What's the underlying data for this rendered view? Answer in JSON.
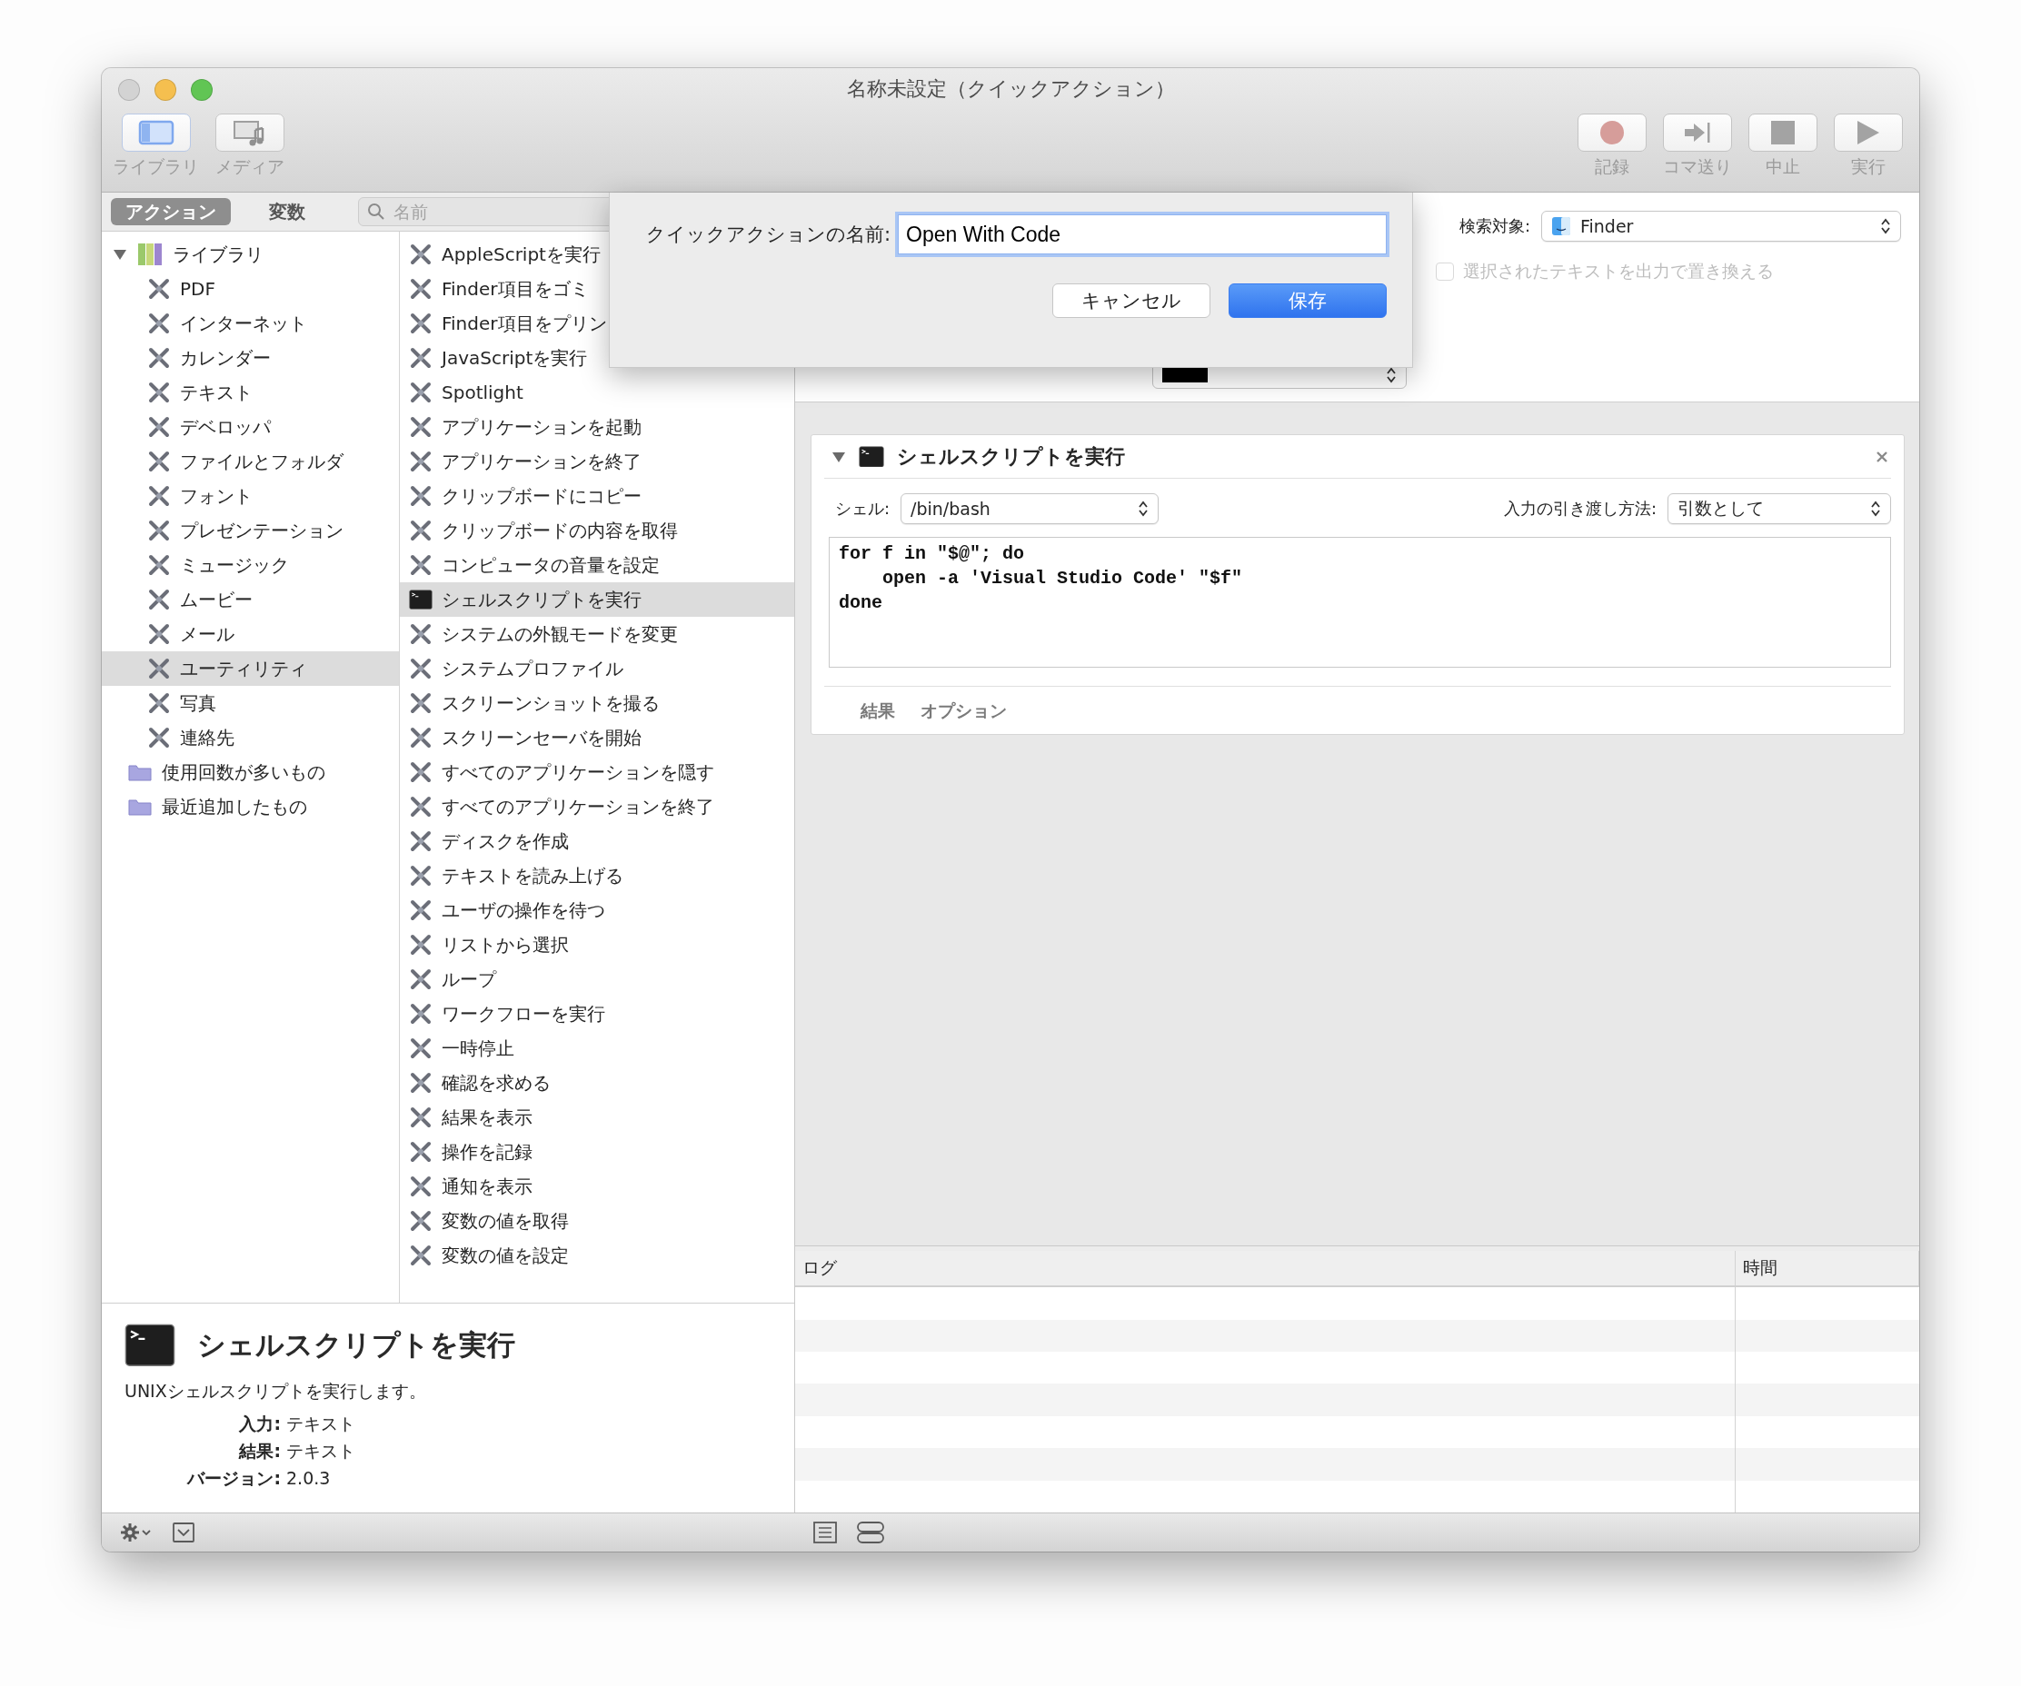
{
  "window": {
    "title": "名称未設定（クイックアクション）"
  },
  "toolbar": {
    "left": [
      {
        "label": "ライブラリ",
        "kind": "library",
        "selected": true
      },
      {
        "label": "メディア",
        "kind": "media",
        "selected": false
      }
    ],
    "right": [
      {
        "label": "記録",
        "kind": "record"
      },
      {
        "label": "コマ送り",
        "kind": "step"
      },
      {
        "label": "中止",
        "kind": "stop"
      },
      {
        "label": "実行",
        "kind": "run"
      }
    ]
  },
  "library_tabs": [
    {
      "label": "アクション",
      "selected": true
    },
    {
      "label": "変数",
      "selected": false
    }
  ],
  "search": {
    "placeholder": "名前"
  },
  "library": [
    {
      "label": "ライブラリ",
      "selected": false,
      "expanded": true,
      "children": [
        {
          "label": "PDF",
          "selected": false
        },
        {
          "label": "インターネット",
          "selected": false
        },
        {
          "label": "カレンダー",
          "selected": false
        },
        {
          "label": "テキスト",
          "selected": false
        },
        {
          "label": "デベロッパ",
          "selected": false
        },
        {
          "label": "ファイルとフォルダ",
          "selected": false
        },
        {
          "label": "フォント",
          "selected": false
        },
        {
          "label": "プレゼンテーション",
          "selected": false
        },
        {
          "label": "ミュージック",
          "selected": false
        },
        {
          "label": "ムービー",
          "selected": false
        },
        {
          "label": "メール",
          "selected": false
        },
        {
          "label": "ユーティリティ",
          "selected": true
        },
        {
          "label": "写真",
          "selected": false
        },
        {
          "label": "連絡先",
          "selected": false
        }
      ]
    },
    {
      "label": "使用回数が多いもの",
      "selected": false
    },
    {
      "label": "最近追加したもの",
      "selected": false
    }
  ],
  "actions": [
    {
      "label": "AppleScriptを実行",
      "selected": false
    },
    {
      "label": "Finder項目をゴミ",
      "selected": false
    },
    {
      "label": "Finder項目をプリン",
      "selected": false
    },
    {
      "label": "JavaScriptを実行",
      "selected": false
    },
    {
      "label": "Spotlight",
      "selected": false
    },
    {
      "label": "アプリケーションを起動",
      "selected": false
    },
    {
      "label": "アプリケーションを終了",
      "selected": false
    },
    {
      "label": "クリップボードにコピー",
      "selected": false
    },
    {
      "label": "クリップボードの内容を取得",
      "selected": false
    },
    {
      "label": "コンピュータの音量を設定",
      "selected": false
    },
    {
      "label": "シェルスクリプトを実行",
      "selected": true
    },
    {
      "label": "システムの外観モードを変更",
      "selected": false
    },
    {
      "label": "システムプロファイル",
      "selected": false
    },
    {
      "label": "スクリーンショットを撮る",
      "selected": false
    },
    {
      "label": "スクリーンセーバを開始",
      "selected": false
    },
    {
      "label": "すべてのアプリケーションを隠す",
      "selected": false
    },
    {
      "label": "すべてのアプリケーションを終了",
      "selected": false
    },
    {
      "label": "ディスクを作成",
      "selected": false
    },
    {
      "label": "テキストを読み上げる",
      "selected": false
    },
    {
      "label": "ユーザの操作を待つ",
      "selected": false
    },
    {
      "label": "リストから選択",
      "selected": false
    },
    {
      "label": "ループ",
      "selected": false
    },
    {
      "label": "ワークフローを実行",
      "selected": false
    },
    {
      "label": "一時停止",
      "selected": false
    },
    {
      "label": "確認を求める",
      "selected": false
    },
    {
      "label": "結果を表示",
      "selected": false
    },
    {
      "label": "操作を記録",
      "selected": false
    },
    {
      "label": "通知を表示",
      "selected": false
    },
    {
      "label": "変数の値を取得",
      "selected": false
    },
    {
      "label": "変数の値を設定",
      "selected": false
    }
  ],
  "description": {
    "title": "シェルスクリプトを実行",
    "text": "UNIXシェルスクリプトを実行します。",
    "fields": [
      {
        "label": "入力:",
        "value": "テキスト"
      },
      {
        "label": "結果:",
        "value": "テキスト"
      },
      {
        "label": "バージョン:",
        "value": "2.0.3"
      }
    ]
  },
  "workflow_header": {
    "search_label": "検索対象:",
    "search_target": "Finder",
    "replace_option": {
      "label": "選択されたテキストを出力で置き換える",
      "checked": false,
      "disabled": true
    }
  },
  "action_card": {
    "title": "シェルスクリプトを実行",
    "expanded": true,
    "shell_label": "シェル:",
    "shell": "/bin/bash",
    "input_label": "入力の引き渡し方法:",
    "input_mode": "引数として",
    "script": "for f in \"$@\"; do\n    open -a 'Visual Studio Code' \"$f\"\ndone",
    "tabs": [
      {
        "label": "結果"
      },
      {
        "label": "オプション"
      }
    ]
  },
  "log": {
    "columns": [
      "ログ",
      "時間"
    ]
  },
  "sheet": {
    "label": "クイックアクションの名前:",
    "value": "Open With Code",
    "buttons": [
      {
        "label": "キャンセル",
        "kind": "normal"
      },
      {
        "label": "保存",
        "kind": "default"
      }
    ]
  }
}
